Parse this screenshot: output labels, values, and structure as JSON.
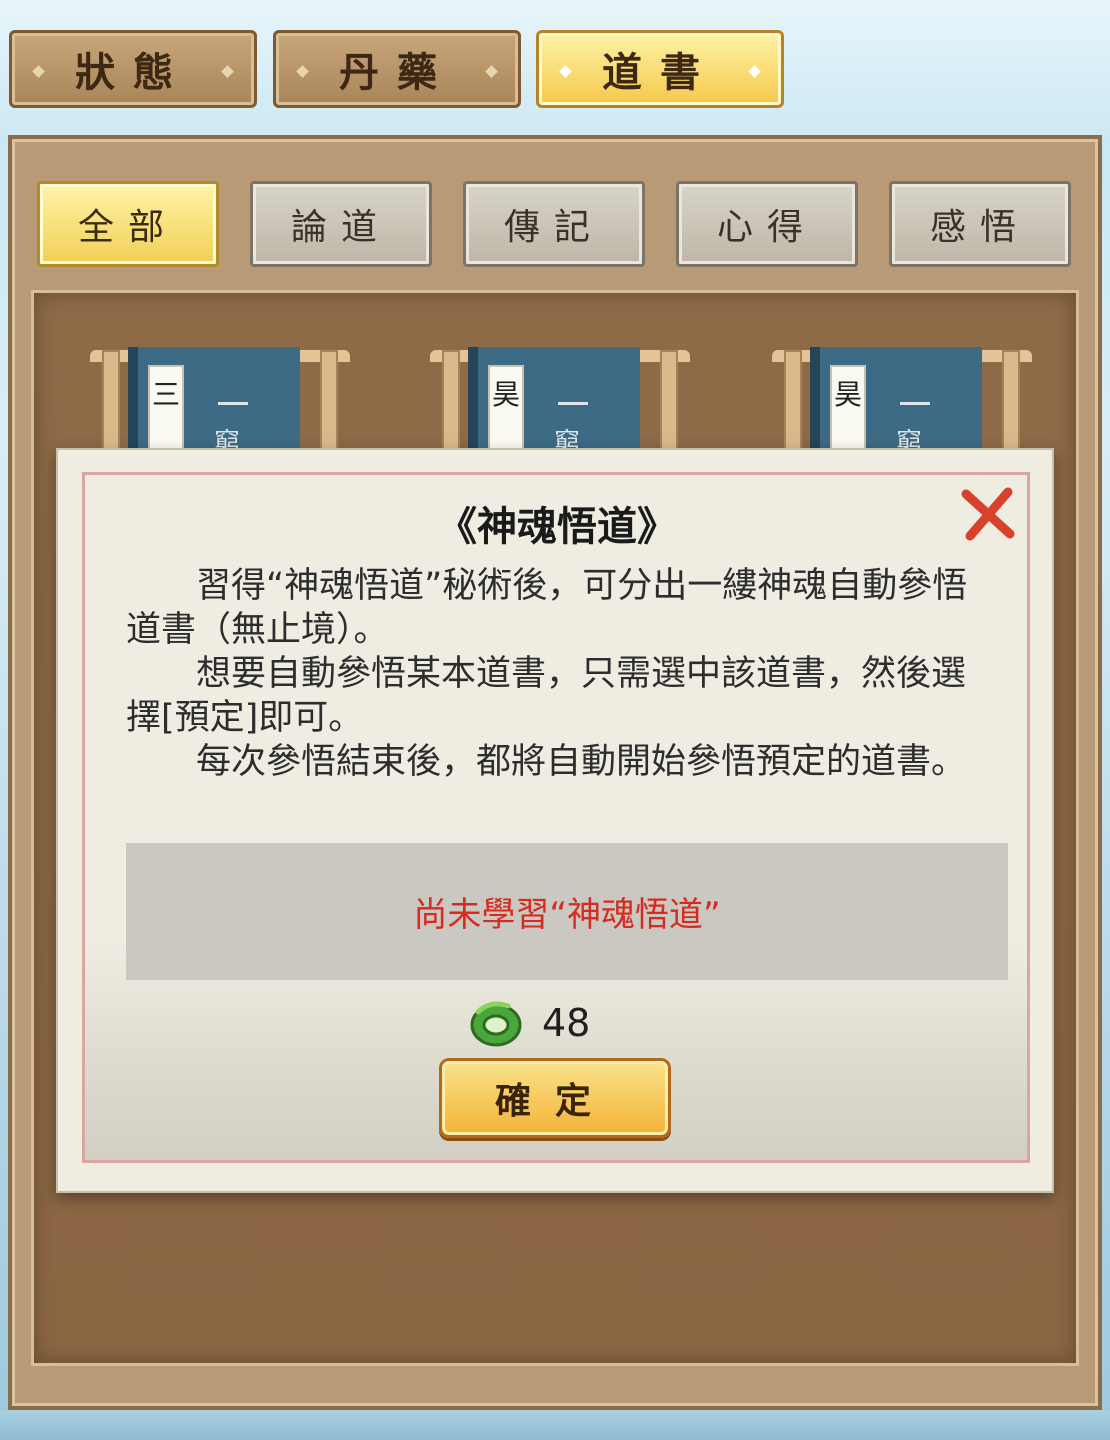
{
  "top_tabs": [
    {
      "label": "狀態",
      "active": false
    },
    {
      "label": "丹藥",
      "active": false
    },
    {
      "label": "道書",
      "active": true
    }
  ],
  "sub_tabs": [
    {
      "label": "全部",
      "active": true
    },
    {
      "label": "論道",
      "active": false
    },
    {
      "label": "傳記",
      "active": false
    },
    {
      "label": "心得",
      "active": false
    },
    {
      "label": "感悟",
      "active": false
    }
  ],
  "books": [
    {
      "title_fragment": "三",
      "level_fragment": "一",
      "level_partial": "窮"
    },
    {
      "title_fragment": "昊",
      "level_fragment": "一",
      "level_partial": "窮"
    },
    {
      "title_fragment": "昊",
      "level_fragment": "一",
      "level_partial": "窮"
    }
  ],
  "dialog": {
    "title": "《神魂悟道》",
    "paragraphs": [
      "習得“神魂悟道”秘術後，可分出一縷神魂自動參悟道書（無止境）。",
      "想要自動參悟某本道書，只需選中該道書，然後選擇[預定]即可。",
      "每次參悟結束後，都將自動開始參悟預定的道書。"
    ],
    "status_text": "尚未學習“神魂悟道”",
    "cost_icon": "jade-dragon-icon",
    "cost_amount": "48",
    "confirm_label": "確定"
  },
  "colors": {
    "status_red": "#d62b20",
    "active_tab": "#f5c84b",
    "panel_brown": "#b89a77"
  }
}
